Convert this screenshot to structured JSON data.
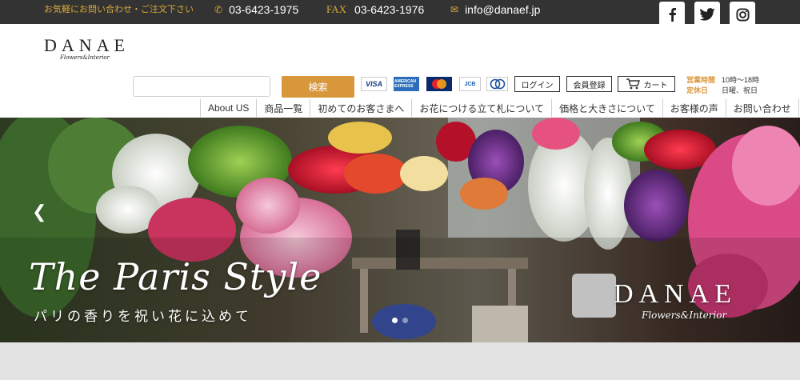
{
  "topbar": {
    "inquiry": "お気軽にお問い合わせ・ご注文下さい",
    "phone": "03-6423-1975",
    "fax_label": "FAX",
    "fax": "03-6423-1976",
    "email": "info@danaef.jp",
    "accent_color": "#d9a93a",
    "social_icons": [
      "facebook-icon",
      "twitter-icon",
      "instagram-icon"
    ]
  },
  "logo": {
    "name": "DANAE",
    "tagline": "Flowers&Interior"
  },
  "search": {
    "placeholder": "",
    "button_label": "検索",
    "button_color": "#d9973b"
  },
  "payments": {
    "visa": "VISA",
    "amex": "AMERICAN EXPRESS",
    "jcb": "JCB",
    "diners": "Diners Club"
  },
  "user": {
    "login": "ログイン",
    "register": "会員登録",
    "cart": "カート"
  },
  "hours": {
    "open_label": "営業時間",
    "open_value": "10時～18時",
    "closed_label": "定休日",
    "closed_value": "日曜、祝日"
  },
  "nav": [
    "About US",
    "商品一覧",
    "初めてのお客さまへ",
    "お花につける立て札について",
    "価格と大きさについて",
    "お客様の声",
    "お問い合わせ"
  ],
  "hero": {
    "title": "The Paris Style",
    "subtitle": "パリの香りを祝い花に込めて",
    "watermark": "DANAE",
    "watermark_sub": "Flowers&Interior",
    "slide_count": 2,
    "active_slide": 1
  }
}
